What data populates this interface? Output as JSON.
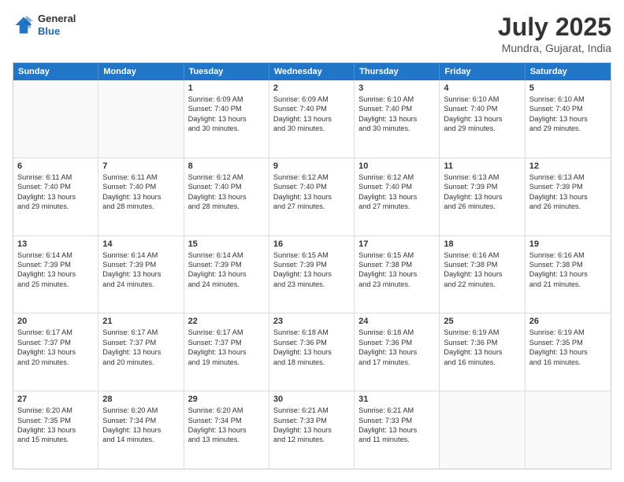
{
  "header": {
    "logo_general": "General",
    "logo_blue": "Blue",
    "month": "July 2025",
    "location": "Mundra, Gujarat, India"
  },
  "weekdays": [
    "Sunday",
    "Monday",
    "Tuesday",
    "Wednesday",
    "Thursday",
    "Friday",
    "Saturday"
  ],
  "rows": [
    [
      {
        "day": "",
        "lines": []
      },
      {
        "day": "",
        "lines": []
      },
      {
        "day": "1",
        "lines": [
          "Sunrise: 6:09 AM",
          "Sunset: 7:40 PM",
          "Daylight: 13 hours",
          "and 30 minutes."
        ]
      },
      {
        "day": "2",
        "lines": [
          "Sunrise: 6:09 AM",
          "Sunset: 7:40 PM",
          "Daylight: 13 hours",
          "and 30 minutes."
        ]
      },
      {
        "day": "3",
        "lines": [
          "Sunrise: 6:10 AM",
          "Sunset: 7:40 PM",
          "Daylight: 13 hours",
          "and 30 minutes."
        ]
      },
      {
        "day": "4",
        "lines": [
          "Sunrise: 6:10 AM",
          "Sunset: 7:40 PM",
          "Daylight: 13 hours",
          "and 29 minutes."
        ]
      },
      {
        "day": "5",
        "lines": [
          "Sunrise: 6:10 AM",
          "Sunset: 7:40 PM",
          "Daylight: 13 hours",
          "and 29 minutes."
        ]
      }
    ],
    [
      {
        "day": "6",
        "lines": [
          "Sunrise: 6:11 AM",
          "Sunset: 7:40 PM",
          "Daylight: 13 hours",
          "and 29 minutes."
        ]
      },
      {
        "day": "7",
        "lines": [
          "Sunrise: 6:11 AM",
          "Sunset: 7:40 PM",
          "Daylight: 13 hours",
          "and 28 minutes."
        ]
      },
      {
        "day": "8",
        "lines": [
          "Sunrise: 6:12 AM",
          "Sunset: 7:40 PM",
          "Daylight: 13 hours",
          "and 28 minutes."
        ]
      },
      {
        "day": "9",
        "lines": [
          "Sunrise: 6:12 AM",
          "Sunset: 7:40 PM",
          "Daylight: 13 hours",
          "and 27 minutes."
        ]
      },
      {
        "day": "10",
        "lines": [
          "Sunrise: 6:12 AM",
          "Sunset: 7:40 PM",
          "Daylight: 13 hours",
          "and 27 minutes."
        ]
      },
      {
        "day": "11",
        "lines": [
          "Sunrise: 6:13 AM",
          "Sunset: 7:39 PM",
          "Daylight: 13 hours",
          "and 26 minutes."
        ]
      },
      {
        "day": "12",
        "lines": [
          "Sunrise: 6:13 AM",
          "Sunset: 7:39 PM",
          "Daylight: 13 hours",
          "and 26 minutes."
        ]
      }
    ],
    [
      {
        "day": "13",
        "lines": [
          "Sunrise: 6:14 AM",
          "Sunset: 7:39 PM",
          "Daylight: 13 hours",
          "and 25 minutes."
        ]
      },
      {
        "day": "14",
        "lines": [
          "Sunrise: 6:14 AM",
          "Sunset: 7:39 PM",
          "Daylight: 13 hours",
          "and 24 minutes."
        ]
      },
      {
        "day": "15",
        "lines": [
          "Sunrise: 6:14 AM",
          "Sunset: 7:39 PM",
          "Daylight: 13 hours",
          "and 24 minutes."
        ]
      },
      {
        "day": "16",
        "lines": [
          "Sunrise: 6:15 AM",
          "Sunset: 7:39 PM",
          "Daylight: 13 hours",
          "and 23 minutes."
        ]
      },
      {
        "day": "17",
        "lines": [
          "Sunrise: 6:15 AM",
          "Sunset: 7:38 PM",
          "Daylight: 13 hours",
          "and 23 minutes."
        ]
      },
      {
        "day": "18",
        "lines": [
          "Sunrise: 6:16 AM",
          "Sunset: 7:38 PM",
          "Daylight: 13 hours",
          "and 22 minutes."
        ]
      },
      {
        "day": "19",
        "lines": [
          "Sunrise: 6:16 AM",
          "Sunset: 7:38 PM",
          "Daylight: 13 hours",
          "and 21 minutes."
        ]
      }
    ],
    [
      {
        "day": "20",
        "lines": [
          "Sunrise: 6:17 AM",
          "Sunset: 7:37 PM",
          "Daylight: 13 hours",
          "and 20 minutes."
        ]
      },
      {
        "day": "21",
        "lines": [
          "Sunrise: 6:17 AM",
          "Sunset: 7:37 PM",
          "Daylight: 13 hours",
          "and 20 minutes."
        ]
      },
      {
        "day": "22",
        "lines": [
          "Sunrise: 6:17 AM",
          "Sunset: 7:37 PM",
          "Daylight: 13 hours",
          "and 19 minutes."
        ]
      },
      {
        "day": "23",
        "lines": [
          "Sunrise: 6:18 AM",
          "Sunset: 7:36 PM",
          "Daylight: 13 hours",
          "and 18 minutes."
        ]
      },
      {
        "day": "24",
        "lines": [
          "Sunrise: 6:18 AM",
          "Sunset: 7:36 PM",
          "Daylight: 13 hours",
          "and 17 minutes."
        ]
      },
      {
        "day": "25",
        "lines": [
          "Sunrise: 6:19 AM",
          "Sunset: 7:36 PM",
          "Daylight: 13 hours",
          "and 16 minutes."
        ]
      },
      {
        "day": "26",
        "lines": [
          "Sunrise: 6:19 AM",
          "Sunset: 7:35 PM",
          "Daylight: 13 hours",
          "and 16 minutes."
        ]
      }
    ],
    [
      {
        "day": "27",
        "lines": [
          "Sunrise: 6:20 AM",
          "Sunset: 7:35 PM",
          "Daylight: 13 hours",
          "and 15 minutes."
        ]
      },
      {
        "day": "28",
        "lines": [
          "Sunrise: 6:20 AM",
          "Sunset: 7:34 PM",
          "Daylight: 13 hours",
          "and 14 minutes."
        ]
      },
      {
        "day": "29",
        "lines": [
          "Sunrise: 6:20 AM",
          "Sunset: 7:34 PM",
          "Daylight: 13 hours",
          "and 13 minutes."
        ]
      },
      {
        "day": "30",
        "lines": [
          "Sunrise: 6:21 AM",
          "Sunset: 7:33 PM",
          "Daylight: 13 hours",
          "and 12 minutes."
        ]
      },
      {
        "day": "31",
        "lines": [
          "Sunrise: 6:21 AM",
          "Sunset: 7:33 PM",
          "Daylight: 13 hours",
          "and 11 minutes."
        ]
      },
      {
        "day": "",
        "lines": []
      },
      {
        "day": "",
        "lines": []
      }
    ]
  ]
}
